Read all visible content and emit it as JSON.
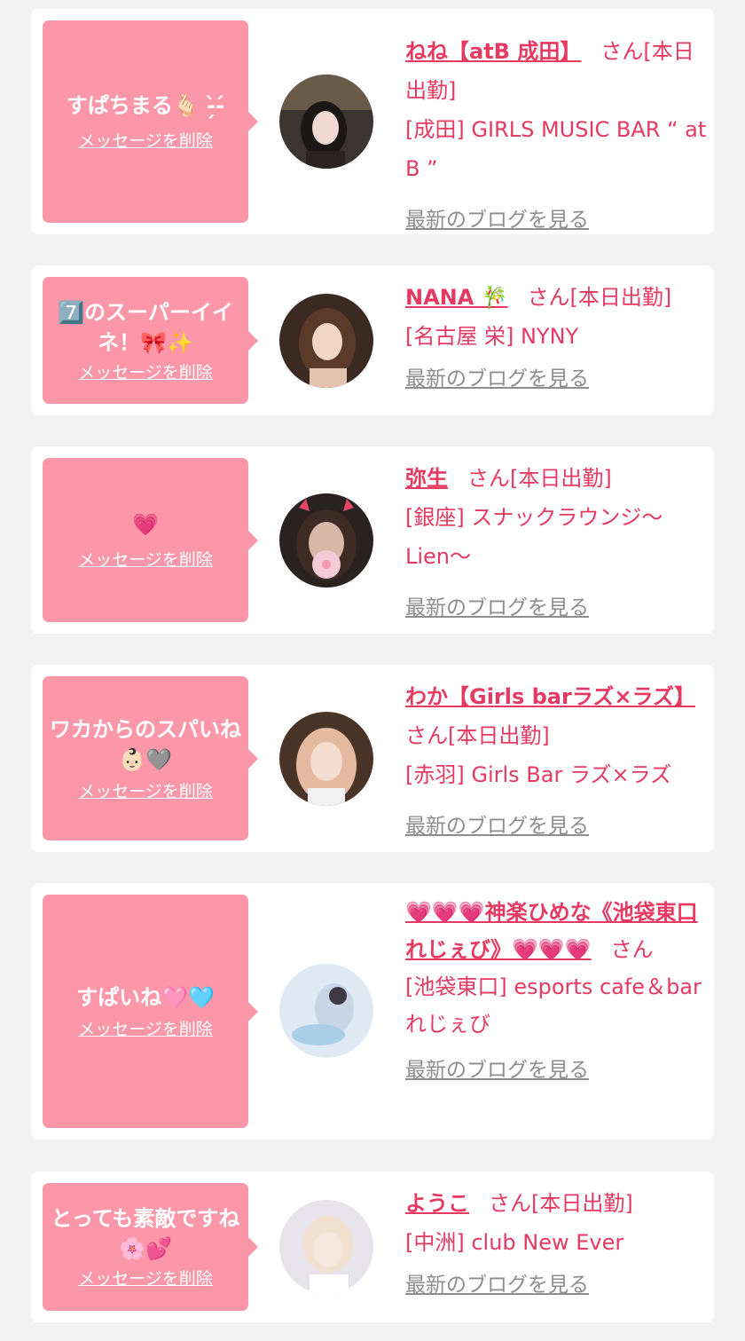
{
  "delete_label": "メッセージを削除",
  "blog_label": "最新のブログを見る",
  "colors": {
    "accent": "#e63a62",
    "bubble": "#fb97a8",
    "link_gray": "#8d8d8d",
    "background": "#f2f2f2"
  },
  "items": [
    {
      "message": "すぱちまる🫰🏻 -̗̀-́",
      "name": "ねね【atB 成田】",
      "suffix": "さん[本日出勤]",
      "shop": "[成田] GIRLS MUSIC BAR “ at B ”",
      "avatar_icon": "avatar-photo"
    },
    {
      "message": "7️⃣のスーパーイイネ！🎀✨",
      "name": "NANA 🎋",
      "suffix": "さん[本日出勤]",
      "shop": "[名古屋 栄] NYNY",
      "avatar_icon": "avatar-photo"
    },
    {
      "message": "💗",
      "name": "弥生",
      "suffix": "さん[本日出勤]",
      "shop": "[銀座] スナックラウンジ〜Lien〜",
      "avatar_icon": "avatar-photo"
    },
    {
      "message": "ワカからのスパいね👶🏻🩶",
      "name": "わか【Girls barラズ×ラズ】",
      "suffix": "さん[本日出勤]",
      "shop": "[赤羽] Girls Bar ラズ×ラズ",
      "avatar_icon": "avatar-photo"
    },
    {
      "message": "すぱいね🩷🩵",
      "name": "💗💗💗神楽ひめな《池袋東口れじぇび》💗💗💗",
      "suffix": "さん",
      "shop": "[池袋東口] esports cafe＆bar れじぇび",
      "avatar_icon": "avatar-photo"
    },
    {
      "message": "とっても素敵ですね🌸💕",
      "name": "ようこ",
      "suffix": "さん[本日出勤]",
      "shop": "[中洲] club New Ever",
      "avatar_icon": "avatar-photo"
    }
  ]
}
